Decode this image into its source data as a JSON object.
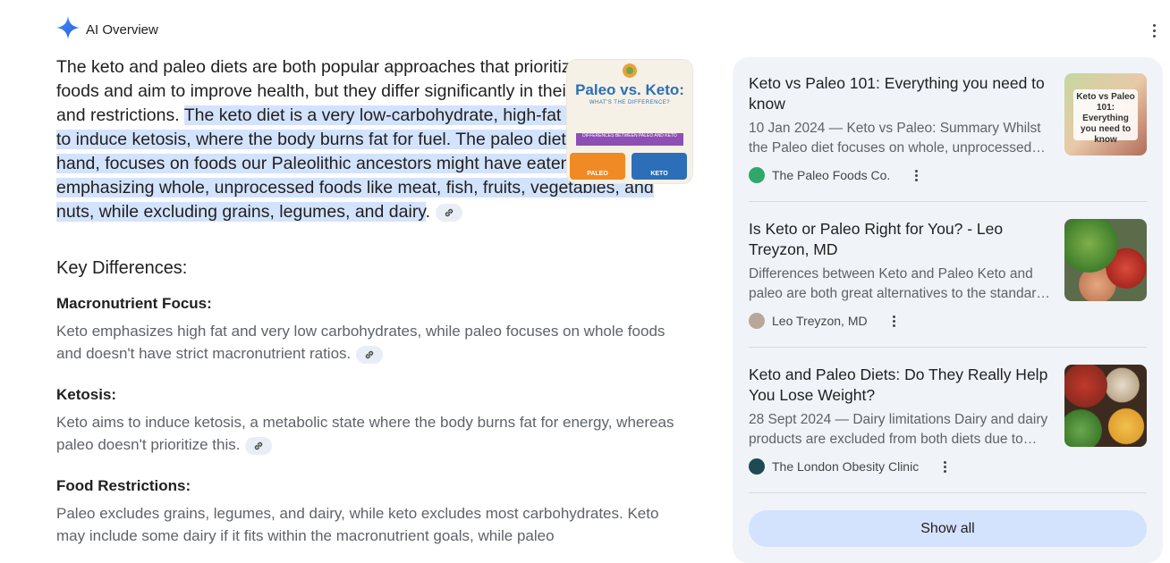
{
  "header": {
    "title": "AI Overview",
    "sparkle_icon": "sparkle-icon",
    "more_icon": "more-vert-icon"
  },
  "main": {
    "intro_plain": "The keto and paleo diets are both popular approaches that prioritize whole foods and aim to improve health, but they differ significantly in their approach and restrictions. ",
    "intro_highlight_1": "The keto diet is a very low-carbohydrate, high-fat diet designed to induce ketosis, where the body burns fat for fuel.",
    "intro_highlight_2": " The paleo diet, on the other hand, focuses on foods our Paleolithic ancestors might have eaten, emphasizing whole, unprocessed foods like meat, fish, fruits, vegetables, and nuts, while excluding grains, legumes, and dairy",
    "intro_end": ".",
    "thumbnail": {
      "title": "Paleo vs. Keto:",
      "subtitle": "WHAT'S THE DIFFERENCE?",
      "banner": "DIFFERENCES BETWEEN PALEO AND KETO",
      "left_label": "PALEO",
      "right_label": "KETO"
    },
    "section_title": "Key Differences:",
    "items": [
      {
        "title": "Macronutrient Focus:",
        "text": "Keto emphasizes high fat and very low carbohydrates, while paleo focuses on whole foods and doesn't have strict macronutrient ratios."
      },
      {
        "title": "Ketosis:",
        "text": "Keto aims to induce ketosis, a metabolic state where the body burns fat for energy, whereas paleo doesn't prioritize this."
      },
      {
        "title": "Food Restrictions:",
        "text": "Paleo excludes grains, legumes, and dairy, while keto excludes most carbohydrates. Keto may include some dairy if it fits within the macronutrient goals, while paleo"
      }
    ],
    "link_icon": "link-icon"
  },
  "sources": [
    {
      "title": "Keto vs Paleo 101: Everything you need to know",
      "snippet": "10 Jan 2024 — Keto vs Paleo: Summary Whilst the Paleo diet focuses on whole, unprocessed foods...",
      "site": "The Paleo Foods Co.",
      "image_text": "Keto vs Paleo 101: Everything you need to know",
      "favicon_color": "#2ea86b"
    },
    {
      "title": "Is Keto or Paleo Right for You? - Leo Treyzon, MD",
      "snippet": "Differences between Keto and Paleo Keto and paleo are both great alternatives to the standard American diet...",
      "site": "Leo Treyzon, MD",
      "favicon_color": "#b9a89a"
    },
    {
      "title": "Keto and Paleo Diets: Do They Really Help You Lose Weight?",
      "snippet": "28 Sept 2024 — Dairy limitations Dairy and dairy products are excluded from both diets due to their...",
      "site": "The London Obesity Clinic",
      "favicon_color": "#1e4a52"
    }
  ],
  "show_all_label": "Show all"
}
